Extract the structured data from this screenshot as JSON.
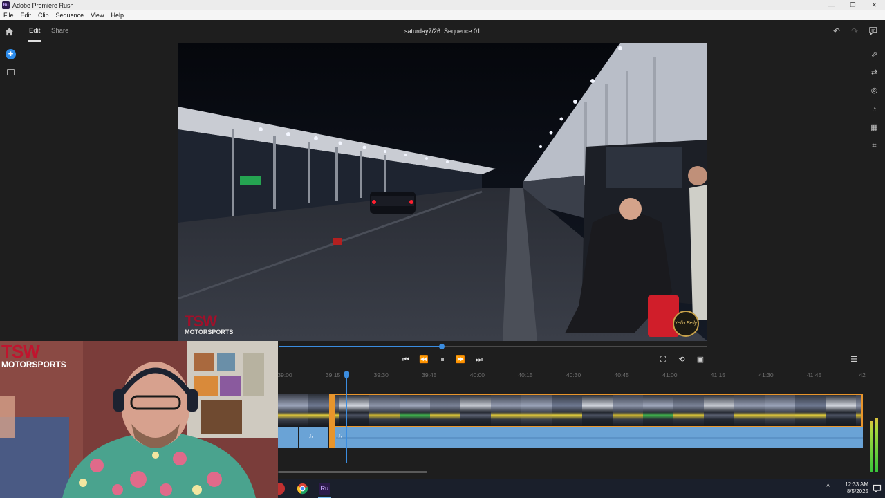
{
  "window": {
    "app_icon": "Ru",
    "title": "Adobe Premiere Rush",
    "controls": [
      "—",
      "❐",
      "✕"
    ]
  },
  "menu": [
    "File",
    "Edit",
    "Clip",
    "Sequence",
    "View",
    "Help"
  ],
  "header": {
    "tabs": [
      {
        "label": "Edit",
        "active": true
      },
      {
        "label": "Share",
        "active": false
      }
    ],
    "sequence_title": "saturday7/26: Sequence 01",
    "icons": [
      "home-icon",
      "undo-icon",
      "redo-icon",
      "comment-icon"
    ]
  },
  "left_rail": {
    "add_label": "+",
    "icons": [
      "add-media-icon",
      "project-assets-icon"
    ]
  },
  "right_rail": {
    "icons": [
      "graphics-icon",
      "effects-icon",
      "color-icon",
      "speed-icon",
      "audio-icon",
      "transform-icon"
    ]
  },
  "preview": {
    "watermark_logo": "TSW",
    "watermark_sub": "MOTORSPORTS",
    "seal_text": "Yello Belly"
  },
  "webcam": {
    "logo_line1": "TSW",
    "logo_line2": "MOTORSPORTS"
  },
  "transport": {
    "progress": 0.38,
    "icons": [
      "go-to-start-icon",
      "step-back-icon",
      "pause-icon",
      "step-forward-icon",
      "go-to-end-icon"
    ],
    "glyphs": [
      "⏮",
      "⏪",
      "⏸",
      "⏩",
      "⏭"
    ],
    "right_icons": [
      "fit-timeline-icon",
      "loop-icon",
      "fullscreen-icon",
      "menu-icon"
    ],
    "right_glyphs": [
      "⛶",
      "⟲",
      "▣",
      "☰"
    ]
  },
  "timeline": {
    "ruler_labels": [
      "39:00",
      "39:15",
      "39:30",
      "39:45",
      "40:00",
      "40:15",
      "40:30",
      "40:45",
      "41:00",
      "41:15",
      "41:30",
      "41:45",
      "42"
    ],
    "playhead_time": "39:17",
    "audio_note": "♫"
  },
  "taskbar": {
    "apps": [
      "record-app-icon",
      "chrome-icon",
      "premiere-rush-icon"
    ],
    "rush_label": "Ru",
    "chevron": "^",
    "time": "12:33 AM",
    "date": "8/5/2025",
    "notification_icon": "notification-icon"
  }
}
